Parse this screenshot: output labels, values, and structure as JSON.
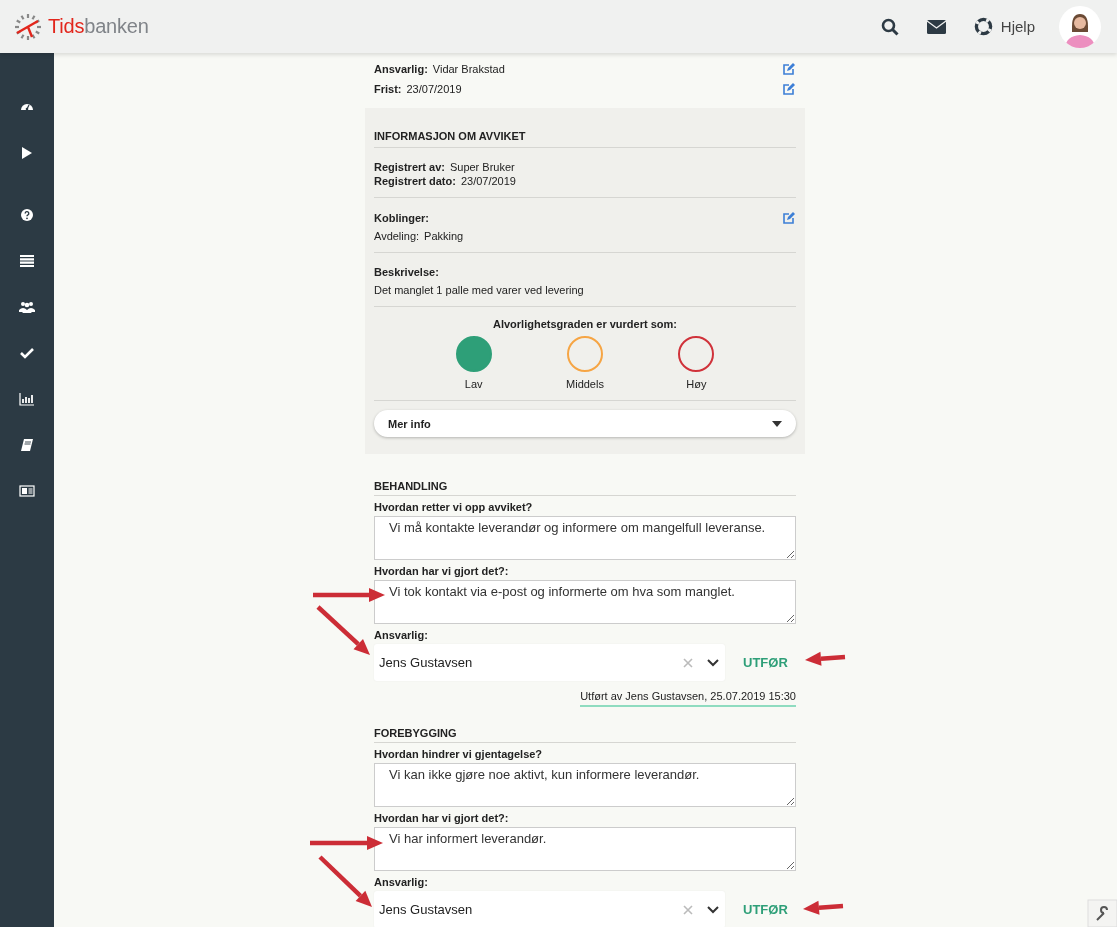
{
  "header": {
    "logo": {
      "accent": "Tids",
      "rest": "banken"
    },
    "help": "Hjelp"
  },
  "task": {
    "fields": [
      {
        "label": "Ansvarlig:",
        "value": "Vidar Brakstad"
      },
      {
        "label": "Frist:",
        "value": "23/07/2019"
      }
    ]
  },
  "info": {
    "title": "INFORMASJON OM AVVIKET",
    "registered": [
      {
        "label": "Registrert av:",
        "value": "Super Bruker"
      },
      {
        "label": "Registrert dato:",
        "value": "23/07/2019"
      }
    ],
    "links": {
      "title": "Koblinger:",
      "items": [
        {
          "label": "Avdeling:",
          "value": "Pakking"
        }
      ]
    },
    "description": {
      "title": "Beskrivelse:",
      "text": "Det manglet 1 palle med varer ved levering"
    },
    "severity": {
      "title": "Alvorlighetsgraden er vurdert som:",
      "levels": [
        {
          "label": "Lav",
          "color": "#2e9f78",
          "selected": true
        },
        {
          "label": "Middels",
          "color": "#f6a544",
          "selected": false
        },
        {
          "label": "Høy",
          "color": "#d0323a",
          "selected": false
        }
      ]
    },
    "more": {
      "label": "Mer info",
      "expanded": false
    }
  },
  "sections": [
    {
      "title": "BEHANDLING",
      "questions": [
        {
          "label": "Hvordan retter vi opp avviket?",
          "value": "Vi må kontakte leverandør og informere om mangelfull leveranse."
        },
        {
          "label": "Hvordan har vi gjort det?:",
          "value": "Vi tok kontakt via e-post og informerte om hva som manglet."
        }
      ],
      "responsible": {
        "label": "Ansvarlig:",
        "value": "Jens Gustavsen"
      },
      "action": "UTFØR",
      "done": "Utført av Jens Gustavsen, 25.07.2019 15:30"
    },
    {
      "title": "FOREBYGGING",
      "questions": [
        {
          "label": "Hvordan hindrer vi gjentagelse?",
          "value": "Vi kan ikke gjøre noe aktivt, kun informere leverandør."
        },
        {
          "label": "Hvordan har vi gjort det?:",
          "value": "Vi har informert leverandør."
        }
      ],
      "responsible": {
        "label": "Ansvarlig:",
        "value": "Jens Gustavsen"
      },
      "action": "UTFØR"
    }
  ]
}
